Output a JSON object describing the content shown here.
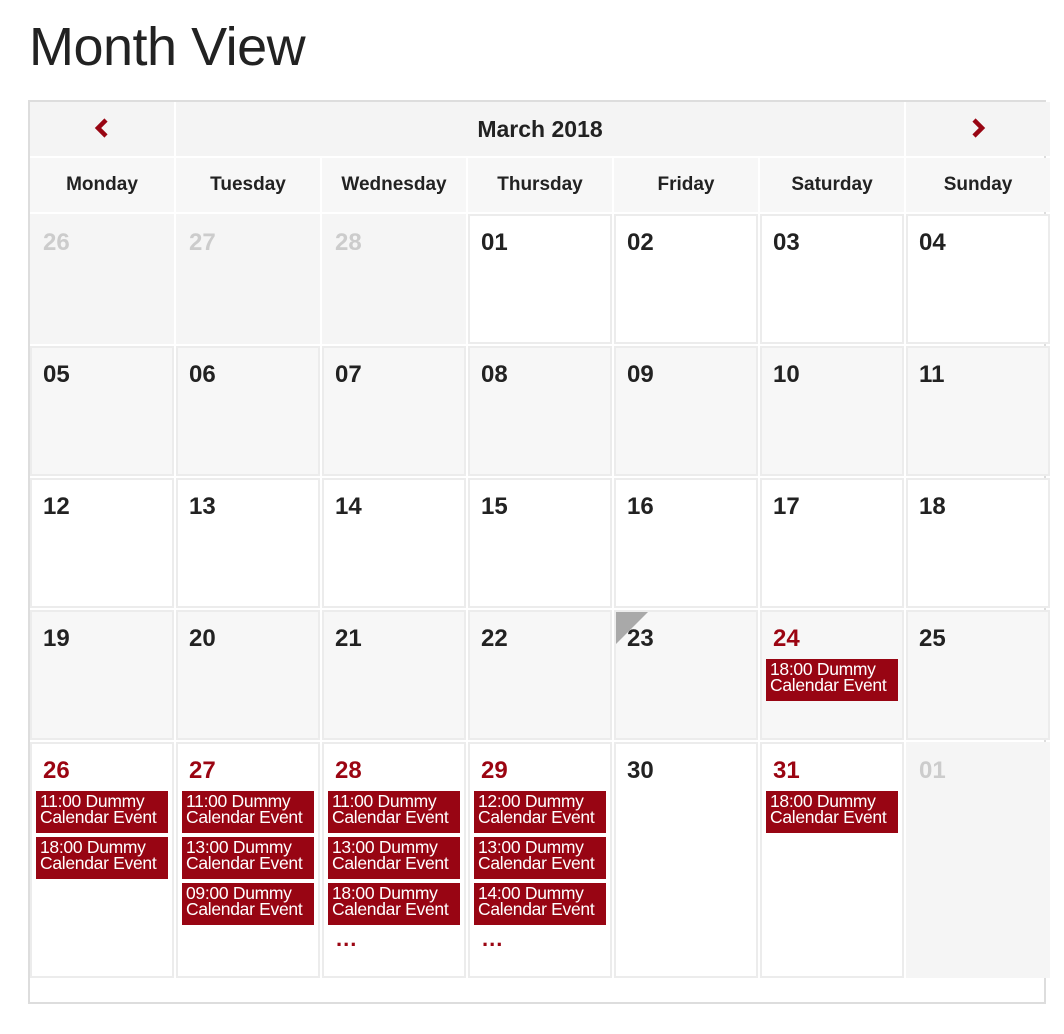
{
  "page": {
    "title": "Month View"
  },
  "calendar": {
    "month_title": "March 2018",
    "prev_icon": "chevron-left-icon",
    "next_icon": "chevron-right-icon",
    "accent_color": "#980513",
    "weekdays": [
      "Monday",
      "Tuesday",
      "Wednesday",
      "Thursday",
      "Friday",
      "Saturday",
      "Sunday"
    ],
    "weeks": [
      {
        "days": [
          {
            "num": "26",
            "other": true,
            "events": []
          },
          {
            "num": "27",
            "other": true,
            "events": []
          },
          {
            "num": "28",
            "other": true,
            "events": []
          },
          {
            "num": "01",
            "events": []
          },
          {
            "num": "02",
            "events": []
          },
          {
            "num": "03",
            "events": []
          },
          {
            "num": "04",
            "events": []
          }
        ]
      },
      {
        "days": [
          {
            "num": "05",
            "events": []
          },
          {
            "num": "06",
            "events": []
          },
          {
            "num": "07",
            "events": []
          },
          {
            "num": "08",
            "events": []
          },
          {
            "num": "09",
            "events": []
          },
          {
            "num": "10",
            "events": []
          },
          {
            "num": "11",
            "events": []
          }
        ]
      },
      {
        "days": [
          {
            "num": "12",
            "events": []
          },
          {
            "num": "13",
            "events": []
          },
          {
            "num": "14",
            "events": []
          },
          {
            "num": "15",
            "events": []
          },
          {
            "num": "16",
            "events": []
          },
          {
            "num": "17",
            "events": []
          },
          {
            "num": "18",
            "events": []
          }
        ]
      },
      {
        "days": [
          {
            "num": "19",
            "events": []
          },
          {
            "num": "20",
            "events": []
          },
          {
            "num": "21",
            "events": []
          },
          {
            "num": "22",
            "events": []
          },
          {
            "num": "23",
            "today_marker": true,
            "events": []
          },
          {
            "num": "24",
            "events": [
              "18:00 Dummy Calendar Event"
            ]
          },
          {
            "num": "25",
            "events": []
          }
        ]
      },
      {
        "days": [
          {
            "num": "26",
            "events": [
              "11:00 Dummy Calendar Event",
              "18:00 Dummy Calendar Event"
            ]
          },
          {
            "num": "27",
            "events": [
              "11:00 Dummy Calendar Event",
              "13:00 Dummy Calendar Event",
              "09:00 Dummy Calendar Event"
            ]
          },
          {
            "num": "28",
            "events": [
              "11:00 Dummy Calendar Event",
              "13:00 Dummy Calendar Event",
              "18:00 Dummy Calendar Event"
            ],
            "more": "..."
          },
          {
            "num": "29",
            "events": [
              "12:00 Dummy Calendar Event",
              "13:00 Dummy Calendar Event",
              "14:00 Dummy Calendar Event"
            ],
            "more": "..."
          },
          {
            "num": "30",
            "events": []
          },
          {
            "num": "31",
            "events": [
              "18:00 Dummy Calendar Event"
            ]
          },
          {
            "num": "01",
            "other": true,
            "events": []
          }
        ]
      }
    ]
  }
}
